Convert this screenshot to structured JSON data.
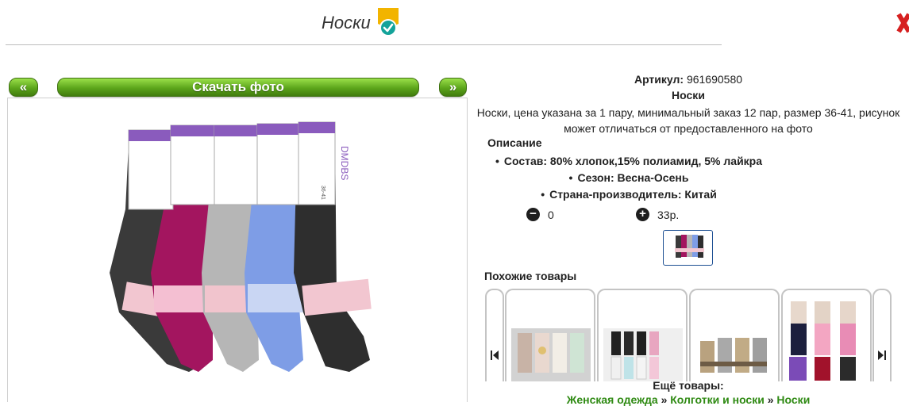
{
  "header": {
    "title": "Носки"
  },
  "nav": {
    "prev_label": "«",
    "download_label": "Скачать фото",
    "next_label": "»"
  },
  "product": {
    "article_label": "Артикул:",
    "article_value": "961690580",
    "name": "Носки",
    "description": "Носки, цена указана за 1 пару, минимальный заказ 12 пар, размер 36-41, рисунок может отличаться от предоставленного на фото",
    "description_heading": "Описание",
    "attributes": [
      "Состав: 80% хлопок,15% полиамид, 5% лайкра",
      "Сезон: Весна-Осень",
      "Страна-производитель: Китай"
    ],
    "quantity": "0",
    "price": "33р.",
    "package_brand": "DMDBS",
    "package_size": "36-41"
  },
  "colors": {
    "accent_green": "#5ca51b",
    "link_green": "#2f8a13",
    "sock_colors": [
      "#3a3a3a",
      "#a3155f",
      "#b6b6b6",
      "#7e9de6",
      "#2e2e2e"
    ]
  },
  "similar": {
    "heading": "Похожие товары",
    "card_count": 4
  },
  "more": {
    "heading": "Ещё товары:",
    "crumbs": [
      "Женская одежда",
      "Колготки и носки",
      "Носки"
    ],
    "separator": "»"
  },
  "icons": [
    "verified-badge-icon",
    "close-icon",
    "minus-icon",
    "plus-icon",
    "chevron-left-icon",
    "chevron-right-icon"
  ]
}
